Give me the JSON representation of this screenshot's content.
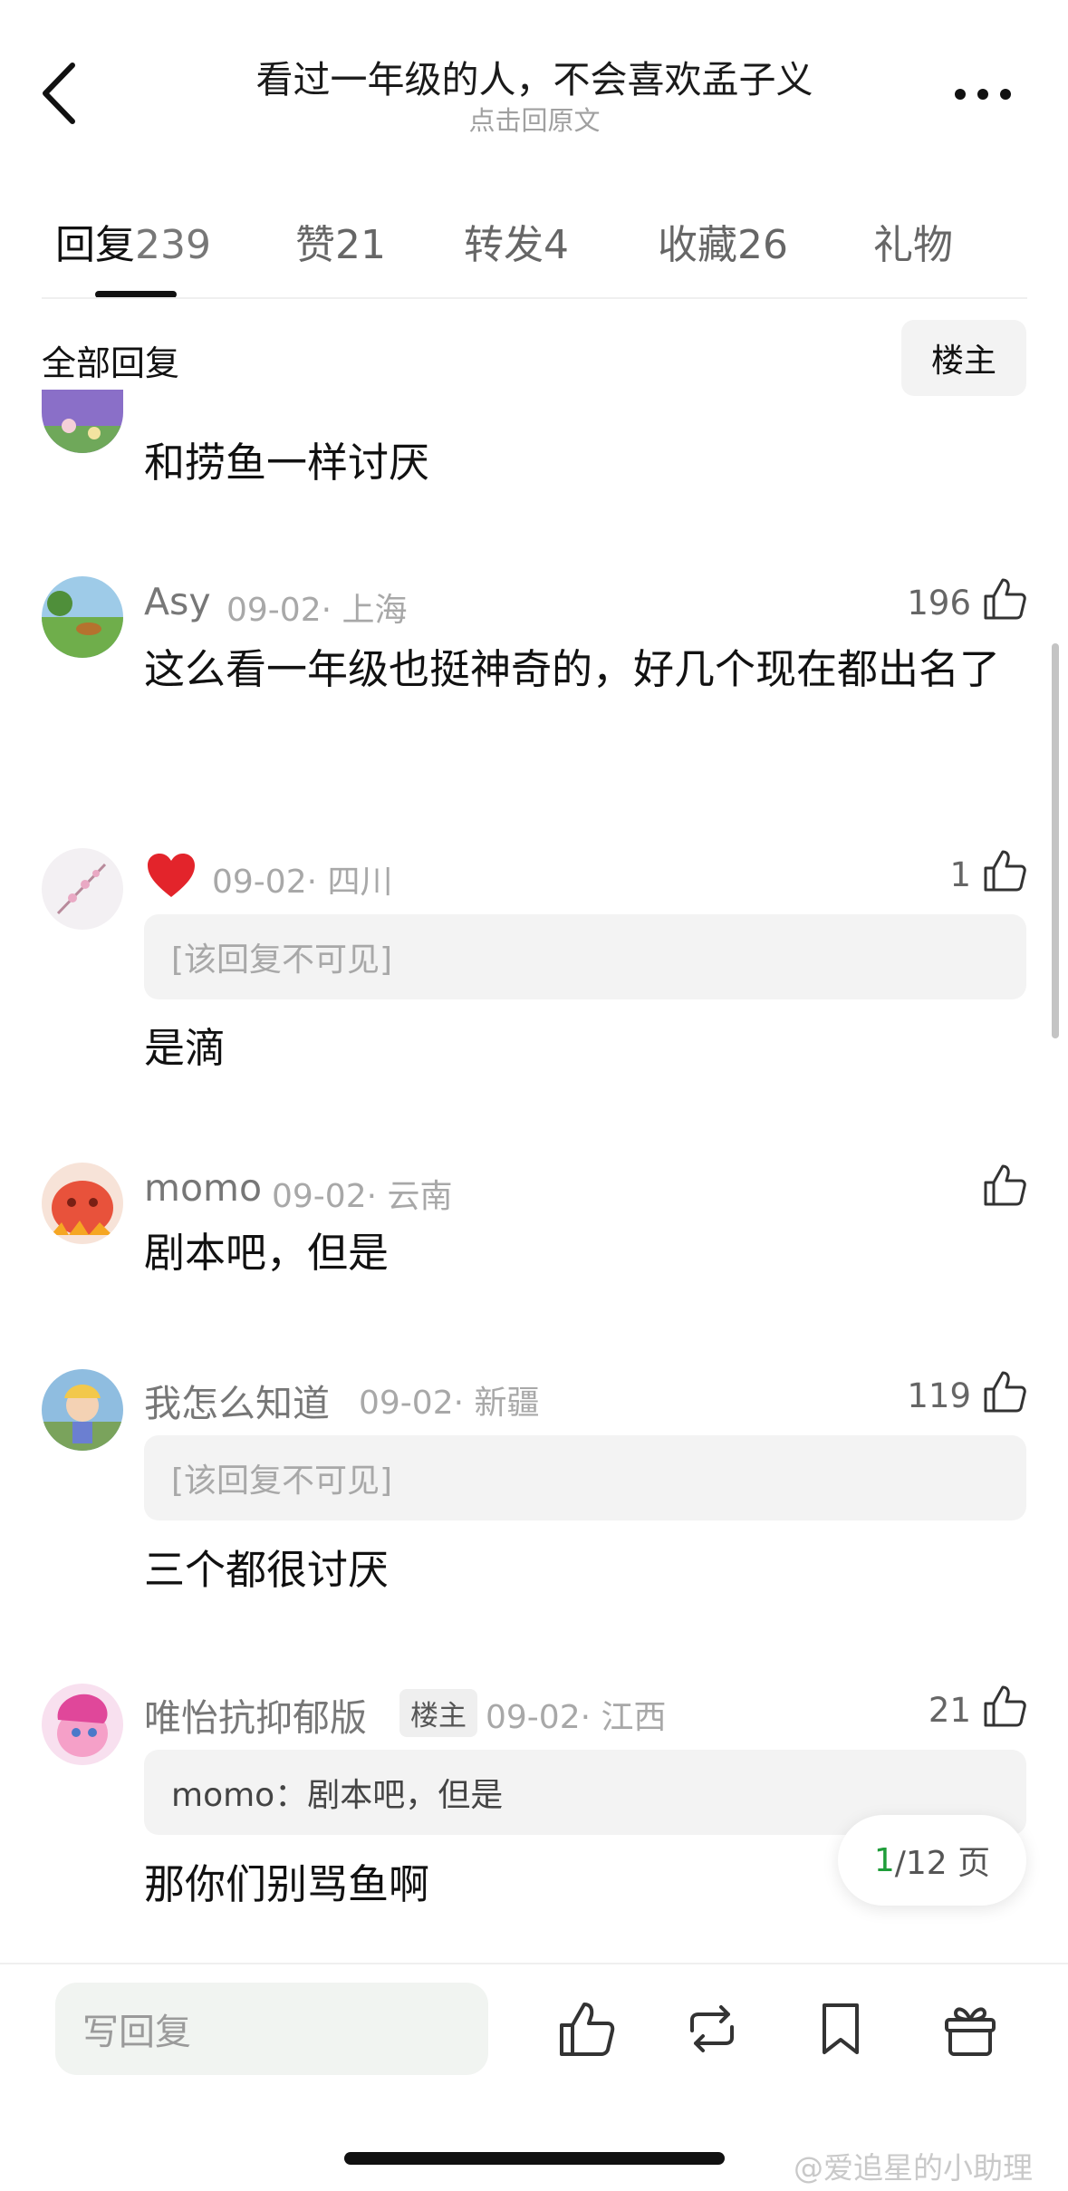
{
  "header": {
    "title": "看过一年级的人，不会喜欢孟子义",
    "subtitle": "点击回原文"
  },
  "tabs": [
    {
      "label": "回复",
      "count": "239"
    },
    {
      "label": "赞",
      "count": "21"
    },
    {
      "label": "转发",
      "count": "4"
    },
    {
      "label": "收藏",
      "count": "26"
    },
    {
      "label": "礼物",
      "count": ""
    }
  ],
  "section": {
    "title": "全部回复",
    "op_filter": "楼主"
  },
  "comments": [
    {
      "partial_text": "和捞鱼一样讨厌"
    },
    {
      "user": "Asy",
      "meta": "09-02· 上海",
      "likes": "196",
      "text": "这么看一年级也挺神奇的，好几个现在都出名了"
    },
    {
      "user": "",
      "meta": "09-02· 四川",
      "likes": "1",
      "quote": "[该回复不可见]",
      "text": "是滴"
    },
    {
      "user": "momo",
      "meta": "09-02· 云南",
      "likes": "",
      "text": "剧本吧，但是"
    },
    {
      "user": "我怎么知道",
      "meta": "09-02· 新疆",
      "likes": "119",
      "quote": "[该回复不可见]",
      "text": "三个都很讨厌"
    },
    {
      "user": "唯怡抗抑郁版",
      "badge": "楼主",
      "meta": "09-02· 江西",
      "likes": "21",
      "quote": "momo：剧本吧，但是",
      "text": "那你们别骂鱼啊"
    }
  ],
  "pagination": {
    "current": "1",
    "total": "/12 页"
  },
  "bottom_bar": {
    "reply_placeholder": "写回复",
    "icons": [
      "like-icon",
      "repost-icon",
      "bookmark-icon",
      "gift-icon"
    ]
  },
  "watermark": "@爱追星的小助理",
  "colors": {
    "accent_green": "#1f9d3a",
    "heart": "#e3242b"
  }
}
